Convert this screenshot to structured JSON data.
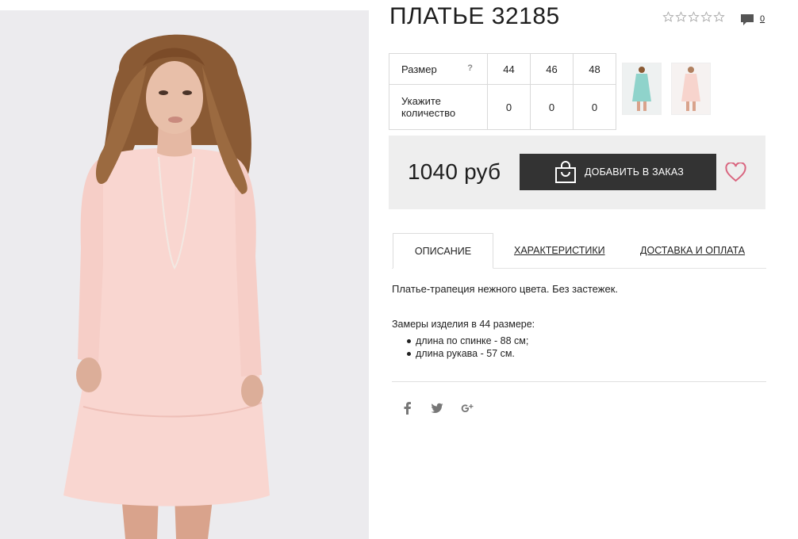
{
  "product": {
    "title": "ПЛАТЬЕ 32185",
    "rating_stars": 0,
    "comments_count": "0"
  },
  "size_table": {
    "size_label": "Размер",
    "help_mark": "?",
    "sizes": [
      "44",
      "46",
      "48"
    ],
    "qty_label_line1": "Укажите",
    "qty_label_line2": "количество",
    "quantities": [
      "0",
      "0",
      "0"
    ]
  },
  "price": {
    "value": "1040 руб",
    "add_button_label": "ДОБАВИТЬ В ЗАКАЗ"
  },
  "tabs": [
    {
      "label": "ОПИСАНИЕ",
      "active": true
    },
    {
      "label": "ХАРАКТЕРИСТИКИ",
      "active": false
    },
    {
      "label": "ДОСТАВКА И ОПЛАТА",
      "active": false
    }
  ],
  "description": {
    "text": "Платье-трапеция нежного цвета. Без застежек.",
    "measure_title": "Замеры изделия в 44 размере:",
    "measures": [
      "длина по спинке - 88 см;",
      "длина рукава - 57 см."
    ]
  },
  "social": [
    "facebook-icon",
    "twitter-icon",
    "google-plus-icon"
  ],
  "colors": {
    "dress": "#f9d6d0",
    "price_box_bg": "#eeeeee",
    "button_bg": "#333333",
    "heart": "#d9657f"
  }
}
